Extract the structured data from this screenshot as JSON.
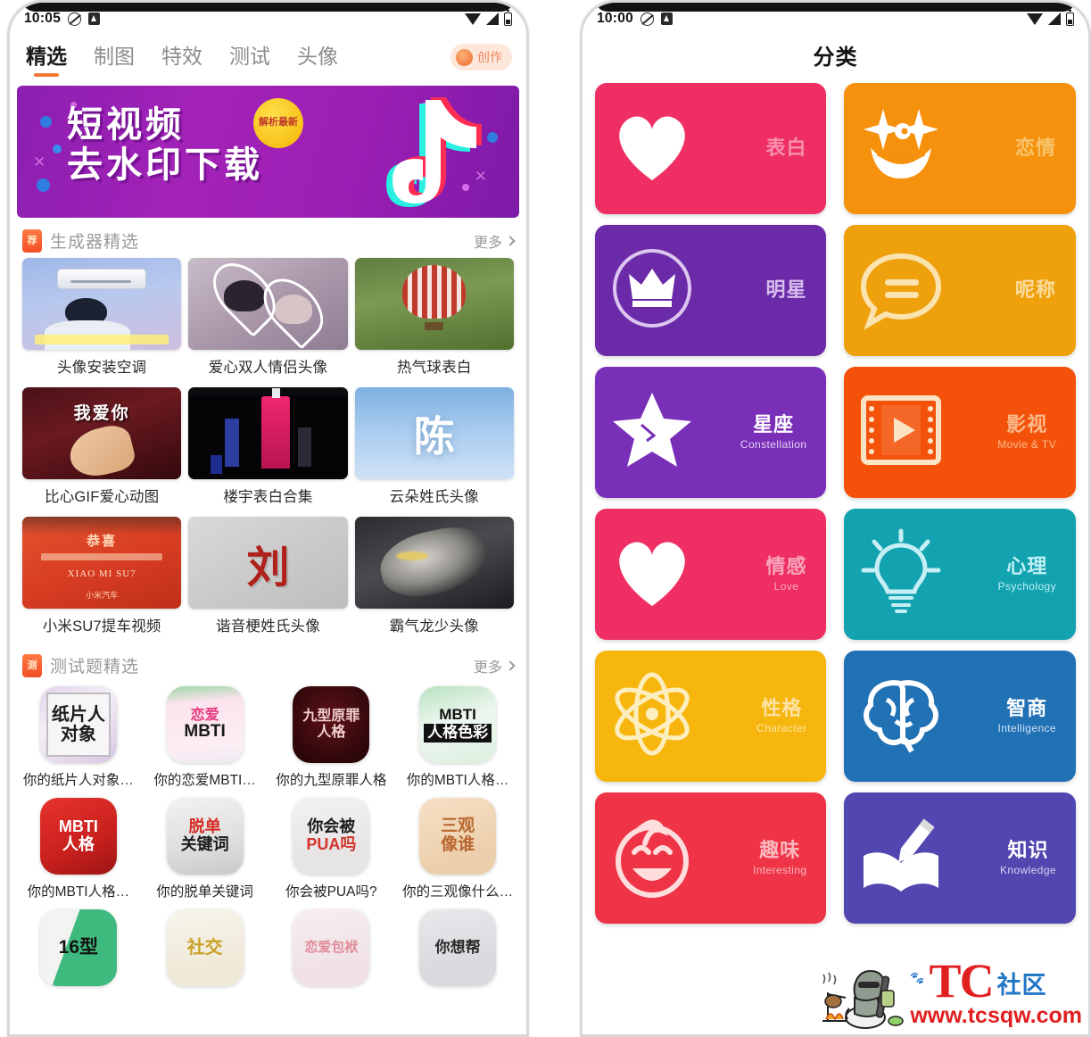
{
  "left_phone": {
    "status_bar": {
      "time": "10:05",
      "icons": [
        "circle-slash-icon",
        "app-square-icon",
        "wifi-icon",
        "signal-icon",
        "battery-icon"
      ]
    },
    "tabs": [
      {
        "label": "精选",
        "active": true
      },
      {
        "label": "制图",
        "active": false
      },
      {
        "label": "特效",
        "active": false
      },
      {
        "label": "测试",
        "active": false
      },
      {
        "label": "头像",
        "active": false
      }
    ],
    "create_button": {
      "label": "创作",
      "icon": "avatar-icon"
    },
    "banner": {
      "line1": "短视频",
      "line2": "去水印下载",
      "badge": "解析最新",
      "logo": "tiktok-note-icon"
    },
    "sections": [
      {
        "badge": "荐",
        "title": "生成器精选",
        "more": "更多",
        "items": [
          {
            "label": "头像安装空调",
            "thumb": "t1"
          },
          {
            "label": "爱心双人情侣头像",
            "thumb": "t2"
          },
          {
            "label": "热气球表白",
            "thumb": "t3"
          },
          {
            "label": "比心GIF爱心动图",
            "thumb": "t4"
          },
          {
            "label": "楼宇表白合集",
            "thumb": "t5"
          },
          {
            "label": "云朵姓氏头像",
            "thumb": "t6"
          },
          {
            "label": "小米SU7提车视频",
            "thumb": "t7"
          },
          {
            "label": "谐音梗姓氏头像",
            "thumb": "t8"
          },
          {
            "label": "霸气龙少头像",
            "thumb": "t9"
          }
        ]
      },
      {
        "badge": "测",
        "title": "测试题精选",
        "more": "更多",
        "items": [
          {
            "label": "你的纸片人对象…",
            "icon_text_1": "纸片人",
            "icon_text_2": "对象",
            "icon": "i1"
          },
          {
            "label": "你的恋爱MBTI…",
            "icon_text_1": "恋爱",
            "icon_text_2": "MBTI",
            "icon": "i2"
          },
          {
            "label": "你的九型原罪人格",
            "icon_text_1": "九型原罪",
            "icon_text_2": "人格",
            "icon": "i3"
          },
          {
            "label": "你的MBTI人格…",
            "icon_text_1": "MBTI",
            "icon_text_2": "人格色彩",
            "icon": "i4"
          },
          {
            "label": "你的MBTI人格…",
            "icon_text_1": "MBTI",
            "icon_text_2": "人格",
            "icon": "i5"
          },
          {
            "label": "你的脱单关键词",
            "icon_text_1": "脱单",
            "icon_text_2": "关键词",
            "icon": "i6"
          },
          {
            "label": "你会被PUA吗?",
            "icon_text_1": "你会被",
            "icon_text_2": "PUA吗",
            "icon": "i7"
          },
          {
            "label": "你的三观像什么…",
            "icon_text_1": "三观",
            "icon_text_2": "像谁",
            "icon": "i8"
          },
          {
            "label": "",
            "icon_text_1": "16型",
            "icon_text_2": "",
            "icon": "i9"
          },
          {
            "label": "",
            "icon_text_1": "社交",
            "icon_text_2": "",
            "icon": "i10"
          },
          {
            "label": "",
            "icon_text_1": "恋爱包袱",
            "icon_text_2": "",
            "icon": "i11"
          },
          {
            "label": "",
            "icon_text_1": "你想帮",
            "icon_text_2": "",
            "icon": "i12"
          }
        ]
      }
    ]
  },
  "right_phone": {
    "status_bar": {
      "time": "10:00",
      "icons": [
        "circle-slash-icon",
        "app-square-icon",
        "wifi-icon",
        "signal-icon",
        "battery-icon"
      ]
    },
    "title": "分类",
    "categories": [
      {
        "cn": "表白",
        "en": "",
        "color": "#ef2f63",
        "text_color": "#f78fae",
        "icon": "heart-icon"
      },
      {
        "cn": "恋情",
        "en": "",
        "color": "#f6910d",
        "text_color": "#f8c46c",
        "icon": "smiley-star-eyes-icon"
      },
      {
        "cn": "明星",
        "en": "",
        "color": "#6b2ba8",
        "text_color": "#c3a1e0",
        "icon": "crown-circle-icon"
      },
      {
        "cn": "呢称",
        "en": "",
        "color": "#eea00d",
        "text_color": "#f9d79a",
        "icon": "chat-bubble-icon"
      },
      {
        "cn": "星座",
        "en": "Constellation",
        "color": "#7a2fb8",
        "text_color": "#ffffff",
        "icon": "star-icon"
      },
      {
        "cn": "影视",
        "en": "Movie & TV",
        "color": "#f4520b",
        "text_color": "#fbbb8a",
        "icon": "film-play-icon"
      },
      {
        "cn": "情感",
        "en": "Love",
        "color": "#ef2f63",
        "text_color": "#f9a5bd",
        "icon": "heart-icon"
      },
      {
        "cn": "心理",
        "en": "Psychology",
        "color": "#12a2b0",
        "text_color": "#b5ecf2",
        "icon": "lightbulb-icon"
      },
      {
        "cn": "性格",
        "en": "Character",
        "color": "#f6b60d",
        "text_color": "#fde3a6",
        "icon": "atom-icon"
      },
      {
        "cn": "智商",
        "en": "Intelligence",
        "color": "#2171b5",
        "text_color": "#ffffff",
        "icon": "brain-icon"
      },
      {
        "cn": "趣味",
        "en": "Interesting",
        "color": "#ee3446",
        "text_color": "#fbb8bf",
        "icon": "laughing-face-icon"
      },
      {
        "cn": "知识",
        "en": "Knowledge",
        "color": "#5246b0",
        "text_color": "#ffffff",
        "icon": "book-pencil-icon"
      }
    ]
  },
  "watermark": {
    "brand": "TC",
    "suffix": "社区",
    "url": "www.tcsqw.com",
    "art": "camper-character-icon"
  }
}
